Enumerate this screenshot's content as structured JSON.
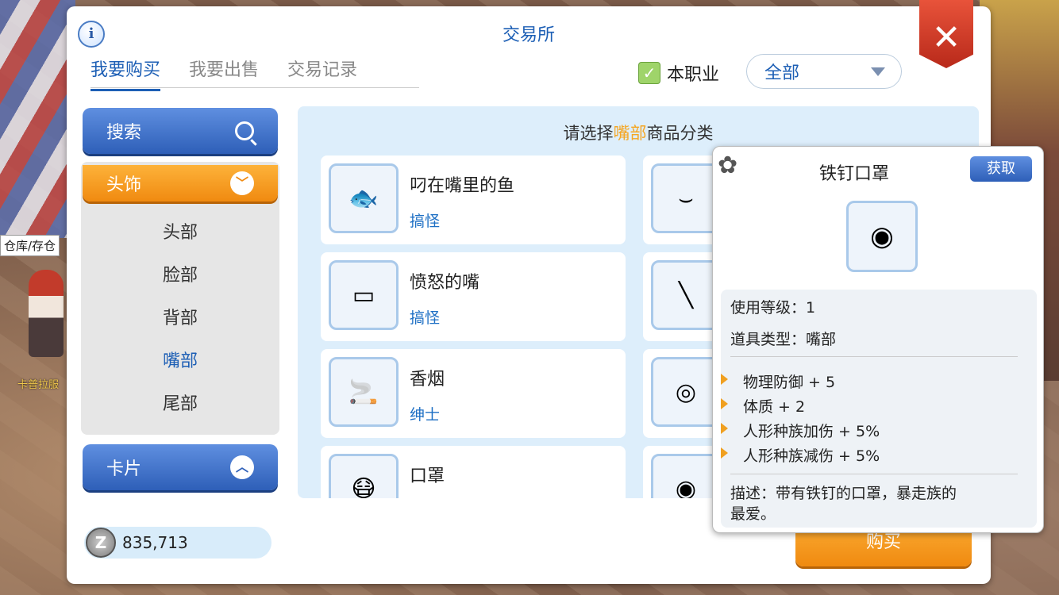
{
  "background": {
    "npc_label": "仓库/存仓",
    "npc_name": "卡普拉服"
  },
  "window": {
    "title": "交易所",
    "info_icon": "info-icon",
    "close_icon": "close-icon"
  },
  "tabs": [
    {
      "label": "我要购买",
      "active": true
    },
    {
      "label": "我要出售",
      "active": false
    },
    {
      "label": "交易记录",
      "active": false
    }
  ],
  "filter": {
    "job_only_label": "本职业",
    "job_only_checked": true,
    "select_value": "全部"
  },
  "sidebar": {
    "search_label": "搜索",
    "category": "头饰",
    "sub_items": [
      {
        "label": "头部",
        "active": false
      },
      {
        "label": "脸部",
        "active": false
      },
      {
        "label": "背部",
        "active": false
      },
      {
        "label": "嘴部",
        "active": true
      },
      {
        "label": "尾部",
        "active": false
      }
    ],
    "card_label": "卡片"
  },
  "zeny": {
    "amount": "835,713"
  },
  "main": {
    "prompt_pre": "请选择",
    "prompt_hl": "嘴部",
    "prompt_post": "商品分类",
    "items": [
      {
        "name": "叼在嘴里的鱼",
        "tag": "搞怪",
        "icon": "fish-icon"
      },
      {
        "name": "愤怒的嘴",
        "tag": "搞怪",
        "icon": "angry-mouth-icon"
      },
      {
        "name": "香烟",
        "tag": "绅士",
        "icon": "cigarette-icon"
      },
      {
        "name": "口罩",
        "tag": "",
        "icon": "mask-icon"
      }
    ],
    "right_items_icons": [
      "fang-icon",
      "pipe-icon",
      "pacifier-icon",
      "spiked-mask-icon"
    ]
  },
  "buy_button": {
    "label": "购买"
  },
  "tooltip": {
    "title": "铁钉口罩",
    "get_label": "获取",
    "level_label": "使用等级：",
    "level_value": "1",
    "type_label": "道具类型：",
    "type_value": "嘴部",
    "stats": [
      "物理防御 + 5",
      "体质 + 2",
      "人形种族加伤 + 5%",
      "人形种族减伤 + 5%"
    ],
    "description_line1": "描述：带有铁钉的口罩，暴走族的",
    "description_line2": "最爱。"
  }
}
